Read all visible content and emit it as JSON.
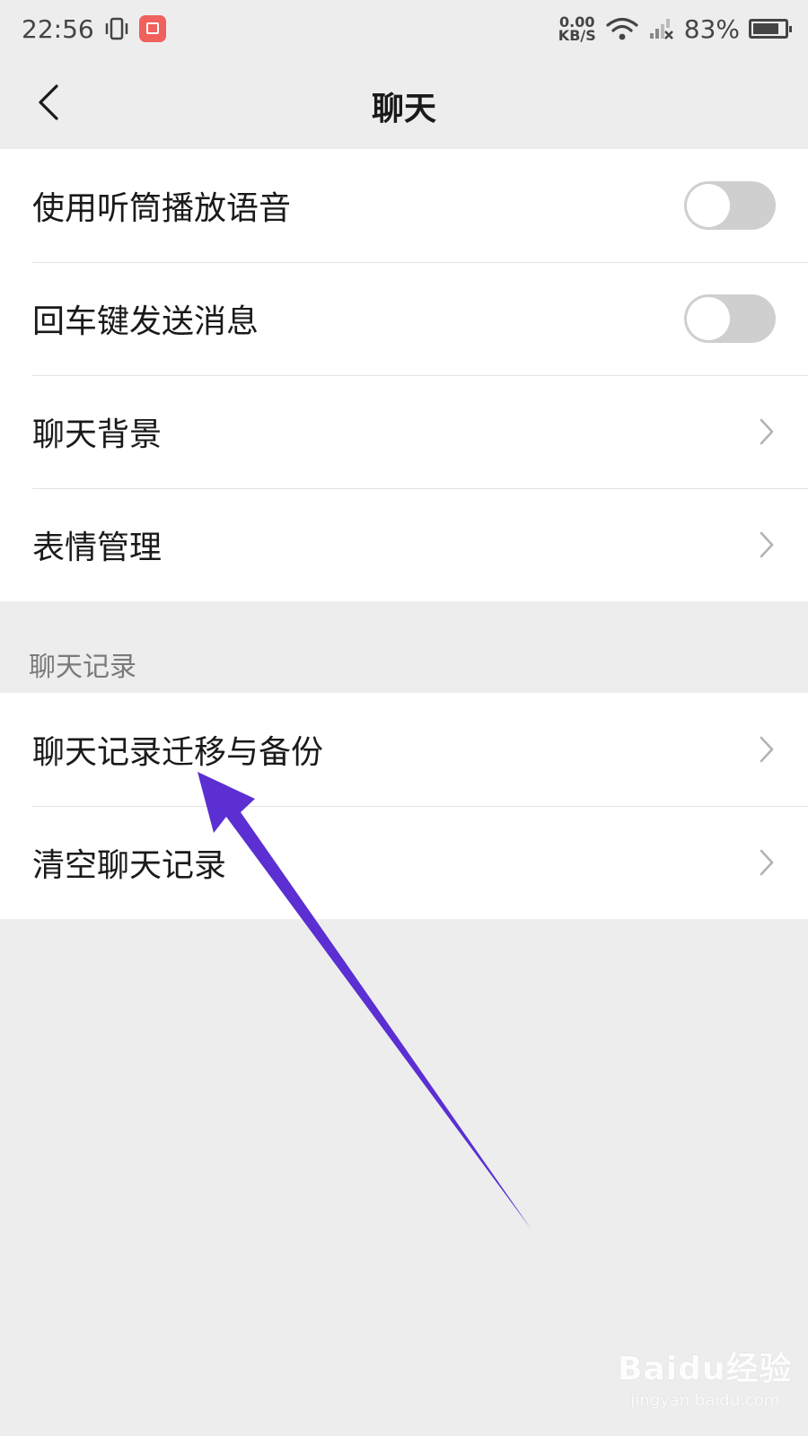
{
  "status_bar": {
    "time": "22:56",
    "net_speed_value": "0.00",
    "net_speed_unit": "KB/S",
    "battery_percent": "83%",
    "battery_level": 0.83
  },
  "nav": {
    "title": "聊天"
  },
  "settings_group_1": {
    "items": [
      {
        "label": "使用听筒播放语音",
        "control": "toggle",
        "on": false
      },
      {
        "label": "回车键发送消息",
        "control": "toggle",
        "on": false
      },
      {
        "label": "聊天背景",
        "control": "chevron"
      },
      {
        "label": "表情管理",
        "control": "chevron"
      }
    ]
  },
  "section_chat_history": {
    "title": "聊天记录",
    "items": [
      {
        "label": "聊天记录迁移与备份",
        "control": "chevron"
      },
      {
        "label": "清空聊天记录",
        "control": "chevron"
      }
    ]
  },
  "annotation": {
    "color": "#5b2fd2"
  },
  "watermark": {
    "text": "Baidu经验",
    "url": "jingyan.baidu.com"
  }
}
